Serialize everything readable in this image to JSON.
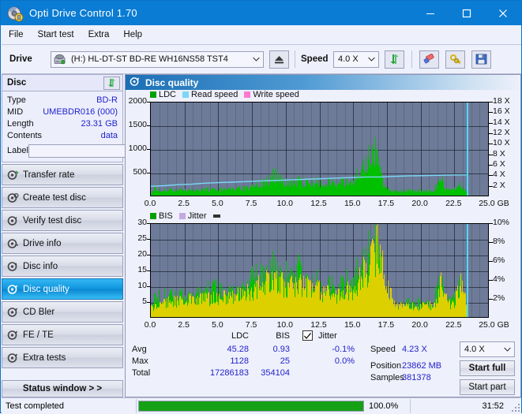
{
  "window": {
    "title": "Opti Drive Control 1.70",
    "icon": "disc-app-icon",
    "minimize": "—",
    "maximize": "☐",
    "close": "✕"
  },
  "menu": {
    "items": [
      "File",
      "Start test",
      "Extra",
      "Help"
    ]
  },
  "toolbar": {
    "drive_label": "Drive",
    "drive_value": "(H:)   HL-DT-ST BD-RE  WH16NS58 TST4",
    "eject_icon": "eject-icon",
    "speed_label": "Speed",
    "speed_value": "4.0 X",
    "refresh_icon": "refresh-icon",
    "erase_icon": "eraser-icon",
    "keys_icon": "keys-icon",
    "save_icon": "save-icon"
  },
  "disc": {
    "title": "Disc",
    "refresh_icon": "refresh-icon",
    "rows": [
      {
        "key": "Type",
        "value": "BD-R"
      },
      {
        "key": "MID",
        "value": "UMEBDR016 (000)"
      },
      {
        "key": "Length",
        "value": "23.31 GB"
      },
      {
        "key": "Contents",
        "value": "data"
      }
    ],
    "label_key": "Label",
    "label_value": "",
    "label_placeholder": "",
    "disc_icon": "disc-icon"
  },
  "nav": {
    "items": [
      {
        "label": "Transfer rate",
        "icon": "transfer-rate-icon",
        "selected": false
      },
      {
        "label": "Create test disc",
        "icon": "create-test-disc-icon",
        "selected": false
      },
      {
        "label": "Verify test disc",
        "icon": "verify-test-disc-icon",
        "selected": false
      },
      {
        "label": "Drive info",
        "icon": "drive-info-icon",
        "selected": false
      },
      {
        "label": "Disc info",
        "icon": "disc-info-icon",
        "selected": false
      },
      {
        "label": "Disc quality",
        "icon": "disc-quality-icon",
        "selected": true
      },
      {
        "label": "CD Bler",
        "icon": "cd-bler-icon",
        "selected": false
      },
      {
        "label": "FE / TE",
        "icon": "fe-te-icon",
        "selected": false
      },
      {
        "label": "Extra tests",
        "icon": "extra-tests-icon",
        "selected": false
      }
    ],
    "status_window": "Status window > >"
  },
  "panel": {
    "title": "Disc quality",
    "icon": "disc-quality-icon"
  },
  "stats": {
    "col_headers": [
      "LDC",
      "BIS"
    ],
    "jitter_label": "Jitter",
    "jitter_checked": true,
    "rows": [
      {
        "key": "Avg",
        "ldc": "45.28",
        "bis": "0.93",
        "jitter": "-0.1%"
      },
      {
        "key": "Max",
        "ldc": "1128",
        "bis": "25",
        "jitter": "0.0%"
      },
      {
        "key": "Total",
        "ldc": "17286183",
        "bis": "354104",
        "jitter": ""
      }
    ],
    "speed_key": "Speed",
    "speed_value": "4.23 X",
    "position_key": "Position",
    "position_value": "23862 MB",
    "samples_key": "Samples",
    "samples_value": "381378",
    "speed_select": "4.0 X",
    "start_full": "Start full",
    "start_part": "Start part"
  },
  "statusbar": {
    "message": "Test completed",
    "progress_text": "100.0%",
    "progress_value": 100,
    "elapsed": "31:52"
  },
  "colors": {
    "title_bar": "#0a7cd4",
    "plot_bg": "#6d7b99",
    "ldc_green": "#00c000",
    "read_speed_cyan": "#7ad7f5",
    "write_speed_pink": "#ff77d0",
    "bis_green": "#00c000",
    "jitter_lilac": "#c6a8e0",
    "scan_marker": "#4fd8f5",
    "value_blue": "#2222cc",
    "progress_green": "#15a015"
  },
  "chart_data": [
    {
      "type": "area",
      "id": "disc-quality-ldc-chart",
      "title": "Disc quality - LDC / Read speed",
      "xlabel": "GB",
      "ylabel": "LDC",
      "xlim": [
        0,
        25
      ],
      "xticks": [
        "0.0",
        "2.5",
        "5.0",
        "7.5",
        "10.0",
        "12.5",
        "15.0",
        "17.5",
        "20.0",
        "22.5",
        "25.0 GB"
      ],
      "ylim": [
        0,
        2000
      ],
      "yticks": [
        "2000",
        "1500",
        "1000",
        "500"
      ],
      "y2lim": [
        0,
        18
      ],
      "y2ticks": [
        "18 X",
        "16 X",
        "14 X",
        "12 X",
        "10 X",
        "8 X",
        "6 X",
        "4 X",
        "2 X"
      ],
      "grid": true,
      "legend_position": "top-left",
      "legend": [
        {
          "name": "LDC",
          "color": "#00a000"
        },
        {
          "name": "Read speed",
          "color": "#7ad7f5"
        },
        {
          "name": "Write speed",
          "color": "#ff77d0"
        }
      ],
      "scan_end_gb": 23.4,
      "series": [
        {
          "name": "LDC",
          "kind": "bars",
          "color": "#00c000",
          "x": [
            0.0,
            0.25,
            0.5,
            0.75,
            1.0,
            1.25,
            1.5,
            1.75,
            2.0,
            2.25,
            2.5,
            2.75,
            3.0,
            3.25,
            3.5,
            3.75,
            4.0,
            4.25,
            4.5,
            4.75,
            5.0,
            5.25,
            5.5,
            5.75,
            6.0,
            6.25,
            6.5,
            6.75,
            7.0,
            7.25,
            7.5,
            7.75,
            8.0,
            8.25,
            8.5,
            8.75,
            9.0,
            9.25,
            9.5,
            9.75,
            10.0,
            10.25,
            10.5,
            10.75,
            11.0,
            11.25,
            11.5,
            11.75,
            12.0,
            12.25,
            12.5,
            12.75,
            13.0,
            13.25,
            13.5,
            13.75,
            14.0,
            14.25,
            14.5,
            14.75,
            15.0,
            15.25,
            15.5,
            15.75,
            16.0,
            16.25,
            16.5,
            16.75,
            17.0,
            17.25,
            17.5,
            17.75,
            18.0,
            18.25,
            18.5,
            18.75,
            19.0,
            19.25,
            19.5,
            19.75,
            20.0,
            20.25,
            20.5,
            20.75,
            21.0,
            21.25,
            21.5,
            21.75,
            22.0,
            22.25,
            22.5,
            22.75,
            23.0,
            23.25,
            23.4
          ],
          "y": [
            60,
            150,
            120,
            135,
            110,
            125,
            115,
            130,
            120,
            110,
            125,
            118,
            140,
            130,
            120,
            135,
            128,
            145,
            130,
            140,
            135,
            130,
            145,
            140,
            150,
            145,
            160,
            150,
            170,
            160,
            200,
            220,
            250,
            280,
            320,
            360,
            430,
            470,
            400,
            330,
            300,
            290,
            320,
            300,
            330,
            310,
            300,
            290,
            280,
            300,
            290,
            280,
            300,
            310,
            290,
            300,
            310,
            290,
            300,
            310,
            330,
            420,
            520,
            640,
            760,
            900,
            1128,
            840,
            560,
            300,
            180,
            120,
            110,
            100,
            105,
            100,
            110,
            105,
            100,
            110,
            105,
            110,
            100,
            105,
            110,
            300,
            430,
            150,
            120,
            110,
            150,
            280,
            260,
            120,
            80
          ]
        },
        {
          "name": "Read speed",
          "kind": "line",
          "color": "#7ad7f5",
          "x": [
            0.0,
            1.0,
            2.0,
            3.0,
            4.0,
            5.0,
            6.0,
            7.0,
            8.0,
            9.0,
            10.0,
            11.0,
            12.0,
            13.0,
            14.0,
            15.0,
            16.0,
            17.0,
            18.0,
            19.0,
            20.0,
            21.0,
            22.0,
            23.0,
            23.4
          ],
          "y": [
            1.8,
            1.9,
            2.1,
            2.2,
            2.4,
            2.5,
            2.6,
            2.7,
            2.8,
            2.9,
            3.0,
            3.1,
            3.2,
            3.3,
            3.4,
            3.5,
            3.6,
            3.6,
            3.7,
            3.8,
            3.85,
            3.9,
            3.95,
            4.0,
            4.0
          ]
        },
        {
          "name": "Write speed",
          "kind": "line",
          "color": "#ff77d0",
          "x": [],
          "y": []
        }
      ]
    },
    {
      "type": "area",
      "id": "disc-quality-bis-chart",
      "title": "Disc quality - BIS / Jitter",
      "xlabel": "GB",
      "ylabel": "BIS",
      "xlim": [
        0,
        25
      ],
      "xticks": [
        "0.0",
        "2.5",
        "5.0",
        "7.5",
        "10.0",
        "12.5",
        "15.0",
        "17.5",
        "20.0",
        "22.5",
        "25.0 GB"
      ],
      "ylim": [
        0,
        30
      ],
      "yticks": [
        "30",
        "25",
        "20",
        "15",
        "10",
        "5"
      ],
      "y2lim": [
        0,
        10
      ],
      "y2ticks": [
        "10%",
        "8%",
        "6%",
        "4%",
        "2%"
      ],
      "grid": true,
      "legend_position": "top-left",
      "legend": [
        {
          "name": "BIS",
          "color": "#00a000"
        },
        {
          "name": "Jitter",
          "color": "#c6a8e0"
        }
      ],
      "scan_end_gb": 23.4,
      "series": [
        {
          "name": "BIS",
          "kind": "bars",
          "color": "#00c000",
          "x": [
            0.0,
            0.25,
            0.5,
            0.75,
            1.0,
            1.25,
            1.5,
            1.75,
            2.0,
            2.25,
            2.5,
            2.75,
            3.0,
            3.25,
            3.5,
            3.75,
            4.0,
            4.25,
            4.5,
            4.75,
            5.0,
            5.25,
            5.5,
            5.75,
            6.0,
            6.25,
            6.5,
            6.75,
            7.0,
            7.25,
            7.5,
            7.75,
            8.0,
            8.25,
            8.5,
            8.75,
            9.0,
            9.25,
            9.5,
            9.75,
            10.0,
            10.25,
            10.5,
            10.75,
            11.0,
            11.25,
            11.5,
            11.75,
            12.0,
            12.25,
            12.5,
            12.75,
            13.0,
            13.25,
            13.5,
            13.75,
            14.0,
            14.25,
            14.5,
            14.75,
            15.0,
            15.25,
            15.5,
            15.75,
            16.0,
            16.25,
            16.5,
            16.75,
            17.0,
            17.25,
            17.5,
            17.75,
            18.0,
            18.25,
            18.5,
            18.75,
            19.0,
            19.25,
            19.5,
            19.75,
            20.0,
            20.25,
            20.5,
            20.75,
            21.0,
            21.25,
            21.5,
            21.75,
            22.0,
            22.25,
            22.5,
            22.75,
            23.0,
            23.25,
            23.4
          ],
          "y": [
            3,
            6,
            7,
            6,
            7,
            6,
            7,
            8,
            6,
            7,
            6,
            7,
            8,
            7,
            9,
            8,
            7,
            9,
            8,
            12,
            9,
            8,
            7,
            8,
            9,
            8,
            7,
            9,
            8,
            10,
            14,
            13,
            12,
            14,
            13,
            15,
            16,
            15,
            14,
            13,
            15,
            14,
            13,
            14,
            16,
            13,
            12,
            11,
            10,
            12,
            10,
            9,
            10,
            11,
            10,
            9,
            11,
            10,
            12,
            11,
            13,
            14,
            16,
            18,
            20,
            23,
            25,
            22,
            18,
            12,
            7,
            5,
            4,
            4,
            4,
            4,
            5,
            4,
            4,
            5,
            4,
            5,
            4,
            4,
            5,
            12,
            13,
            6,
            5,
            5,
            7,
            13,
            12,
            6,
            3
          ]
        },
        {
          "name": "Jitter",
          "kind": "bars",
          "color": "#ddd000",
          "x": [
            0.0,
            1.0,
            2.0,
            3.0,
            4.0,
            5.0,
            6.0,
            7.0,
            8.0,
            9.0,
            10.0,
            11.0,
            12.0,
            13.0,
            14.0,
            15.0,
            15.5,
            16.0,
            16.3,
            16.6,
            16.8,
            17.0,
            17.3,
            17.6,
            18.0,
            19.0,
            20.0,
            21.0,
            21.5,
            22.0,
            22.5,
            23.0,
            23.4
          ],
          "y": [
            1.0,
            1.6,
            1.8,
            1.9,
            2.0,
            2.1,
            2.2,
            2.6,
            3.4,
            4.0,
            3.6,
            3.8,
            3.2,
            2.6,
            2.4,
            3.2,
            4.2,
            5.4,
            6.2,
            7.0,
            8.3,
            6.6,
            5.0,
            3.6,
            1.4,
            1.2,
            1.2,
            1.3,
            3.9,
            1.4,
            1.6,
            4.3,
            1.2
          ]
        }
      ]
    }
  ]
}
